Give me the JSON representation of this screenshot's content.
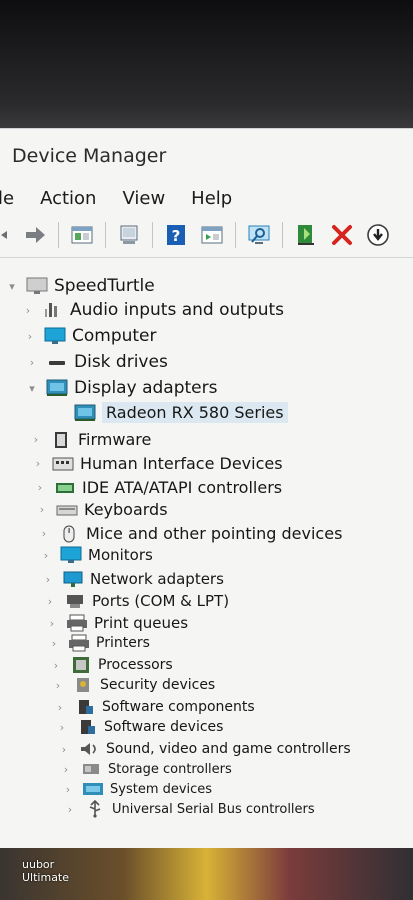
{
  "window": {
    "title": "Device Manager"
  },
  "menu": [
    "le",
    "Action",
    "View",
    "Help"
  ],
  "toolbar": {
    "icons": [
      "back-arrow-icon",
      "forward-arrow-icon",
      "properties-icon",
      "update-driver-icon",
      "help-icon",
      "show-hidden-icon",
      "scan-hardware-icon",
      "enable-device-icon",
      "uninstall-x-icon",
      "download-icon"
    ]
  },
  "tree": {
    "root": "SpeedTurtle",
    "items": [
      {
        "label": "Audio inputs and outputs",
        "icon": "speaker-icon",
        "expanded": false
      },
      {
        "label": "Computer",
        "icon": "monitor-icon",
        "expanded": false
      },
      {
        "label": "Disk drives",
        "icon": "disk-icon",
        "expanded": false
      },
      {
        "label": "Display adapters",
        "icon": "display-adapter-icon",
        "expanded": true,
        "children": [
          {
            "label": "Radeon RX 580 Series",
            "icon": "display-adapter-icon",
            "selected": true
          }
        ]
      },
      {
        "label": "Firmware",
        "icon": "firmware-icon",
        "expanded": false
      },
      {
        "label": "Human Interface Devices",
        "icon": "hid-icon",
        "expanded": false
      },
      {
        "label": "IDE ATA/ATAPI controllers",
        "icon": "ide-icon",
        "expanded": false
      },
      {
        "label": "Keyboards",
        "icon": "keyboard-icon",
        "expanded": false
      },
      {
        "label": "Mice and other pointing devices",
        "icon": "mouse-icon",
        "expanded": false
      },
      {
        "label": "Monitors",
        "icon": "monitor-icon",
        "expanded": false
      },
      {
        "label": "Network adapters",
        "icon": "network-icon",
        "expanded": false
      },
      {
        "label": "Ports (COM & LPT)",
        "icon": "port-icon",
        "expanded": false
      },
      {
        "label": "Print queues",
        "icon": "printer-icon",
        "expanded": false
      },
      {
        "label": "Printers",
        "icon": "printer-icon",
        "expanded": false
      },
      {
        "label": "Processors",
        "icon": "processor-icon",
        "expanded": false
      },
      {
        "label": "Security devices",
        "icon": "security-icon",
        "expanded": false
      },
      {
        "label": "Software components",
        "icon": "software-icon",
        "expanded": false
      },
      {
        "label": "Software devices",
        "icon": "software-icon",
        "expanded": false
      },
      {
        "label": "Sound, video and game controllers",
        "icon": "sound-icon",
        "expanded": false
      },
      {
        "label": "Storage controllers",
        "icon": "storage-icon",
        "expanded": false
      },
      {
        "label": "System devices",
        "icon": "system-icon",
        "expanded": false
      },
      {
        "label": "Universal Serial Bus controllers",
        "icon": "usb-icon",
        "expanded": false
      }
    ]
  },
  "desktop": {
    "label_line1": "uubor",
    "label_line2": "Ultimate"
  },
  "colors": {
    "window_bg": "#f5f6f4",
    "accent_blue": "#1a6fc0",
    "uninstall_red": "#d6241f",
    "selection": "#dbe8f2"
  }
}
